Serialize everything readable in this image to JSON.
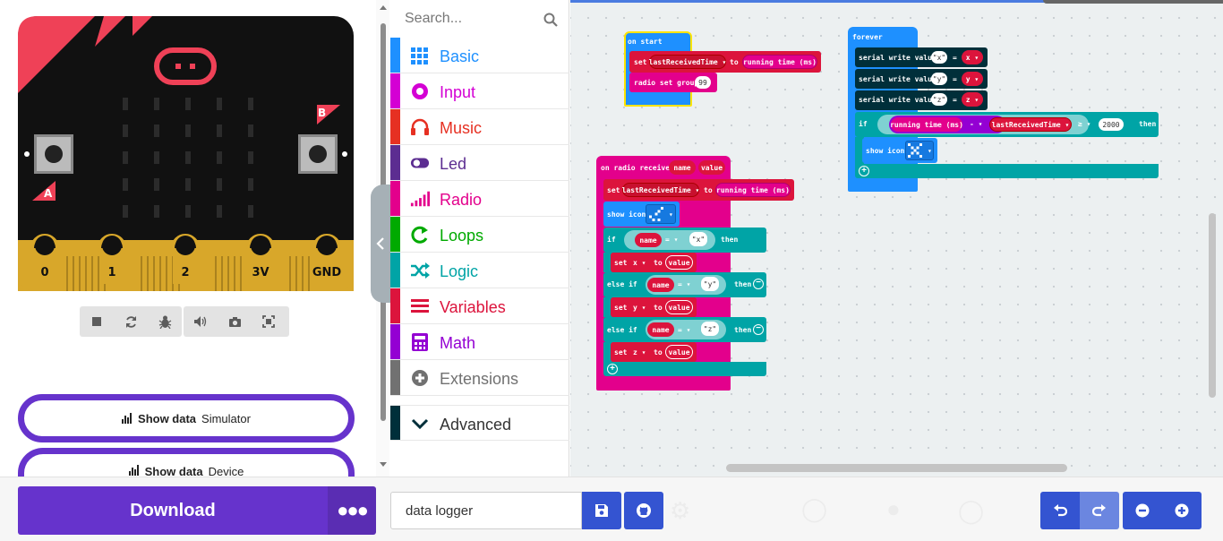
{
  "simulator": {
    "pins": [
      "0",
      "1",
      "2",
      "3V",
      "GND"
    ],
    "button_a": "A",
    "button_b": "B",
    "toolbar": [
      "stop-icon",
      "restart-icon",
      "debug-icon",
      "mute-icon",
      "screenshot-icon",
      "fullscreen-icon"
    ],
    "show_data_simulator": {
      "label": "Show data",
      "sub": "Simulator"
    },
    "show_data_device": {
      "label": "Show data",
      "sub": "Device"
    }
  },
  "toolbox": {
    "search_placeholder": "Search...",
    "categories": [
      {
        "label": "Basic",
        "color": "#1e90ff",
        "icon": "grid-icon"
      },
      {
        "label": "Input",
        "color": "#d400d4",
        "icon": "input-icon"
      },
      {
        "label": "Music",
        "color": "#e63022",
        "icon": "headphones-icon"
      },
      {
        "label": "Led",
        "color": "#5c2d91",
        "icon": "toggle-icon"
      },
      {
        "label": "Radio",
        "color": "#e3008c",
        "icon": "signal-icon"
      },
      {
        "label": "Loops",
        "color": "#00aa00",
        "icon": "loop-icon"
      },
      {
        "label": "Logic",
        "color": "#00a4a6",
        "icon": "shuffle-icon"
      },
      {
        "label": "Variables",
        "color": "#dc143c",
        "icon": "list-icon"
      },
      {
        "label": "Math",
        "color": "#9400d3",
        "icon": "calculator-icon"
      },
      {
        "label": "Extensions",
        "color": "#717171",
        "icon": "plus-circle-icon"
      },
      {
        "label": "Advanced",
        "color": "#002f3a",
        "icon": "chevron-down-icon"
      }
    ]
  },
  "workspace": {
    "on_start": {
      "hat": "on start",
      "set": "set",
      "var": "lastReceivedTime",
      "to": "to",
      "value": "running time (ms)",
      "radio_set_group": "radio set group",
      "group": "99"
    },
    "forever": {
      "hat": "forever",
      "serial_write": "serial write value",
      "rows": [
        {
          "name": "x",
          "var": "x"
        },
        {
          "name": "y",
          "var": "y"
        },
        {
          "name": "z",
          "var": "z"
        }
      ],
      "if": "if",
      "running_time": "running time (ms)",
      "minus": "-",
      "last": "lastReceivedTime",
      "gte": "≥",
      "threshold": "2000",
      "then": "then",
      "show_icon": "show icon"
    },
    "on_radio": {
      "hat": "on radio received",
      "p1": "name",
      "p2": "value",
      "set": "set",
      "var": "lastReceivedTime",
      "to": "to",
      "time": "running time (ms)",
      "show_icon": "show icon",
      "if": "if",
      "else_if": "else if",
      "then": "then",
      "eq": "=",
      "branches": [
        {
          "cmp": "x",
          "var": "x"
        },
        {
          "cmp": "y",
          "var": "y"
        },
        {
          "cmp": "z",
          "var": "z"
        }
      ],
      "name": "name",
      "value": "value"
    }
  },
  "bottom": {
    "download": "Download",
    "project_name": "data logger"
  }
}
